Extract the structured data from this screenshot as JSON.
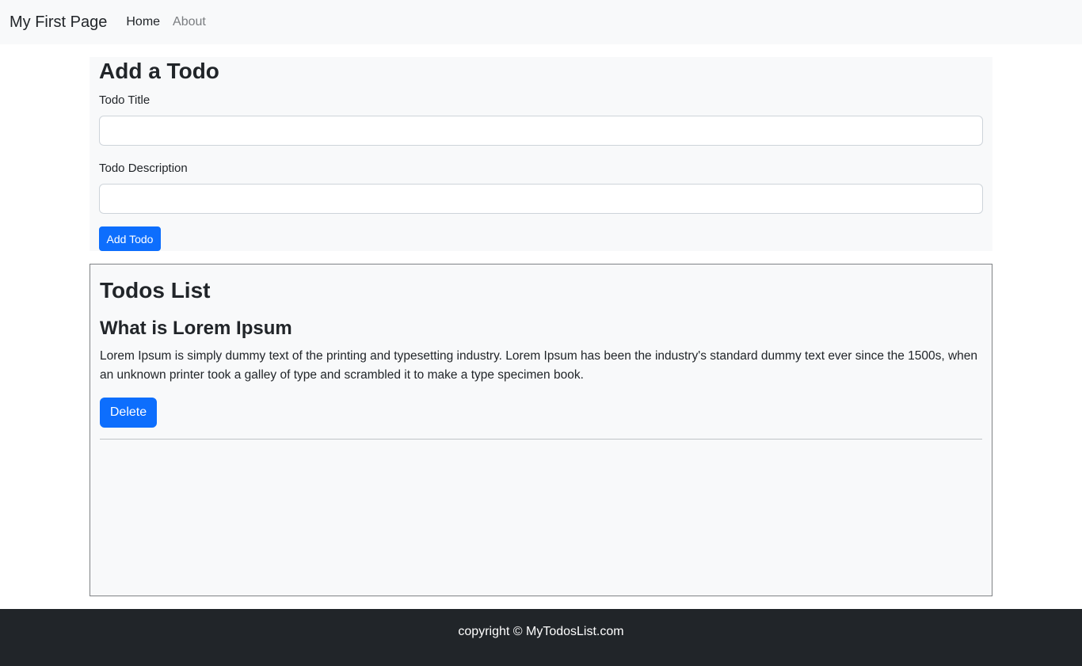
{
  "navbar": {
    "brand": "My First Page",
    "links": [
      {
        "label": "Home"
      },
      {
        "label": "About"
      }
    ]
  },
  "add_todo": {
    "heading": "Add a Todo",
    "title_label": "Todo Title",
    "title_value": "",
    "desc_label": "Todo Description",
    "desc_value": "",
    "submit_label": "Add Todo"
  },
  "todos_list": {
    "heading": "Todos List",
    "items": [
      {
        "title": "What is Lorem Ipsum",
        "description": "Lorem Ipsum is simply dummy text of the printing and typesetting industry. Lorem Ipsum has been the industry's standard dummy text ever since the 1500s, when an unknown printer took a galley of type and scrambled it to make a type specimen book.",
        "delete_label": "Delete"
      }
    ]
  },
  "footer": {
    "text": "copyright © MyTodosList.com"
  },
  "colors": {
    "primary": "#0d6efd",
    "navbar_bg": "#f8f9fa",
    "footer_bg": "#212529"
  }
}
